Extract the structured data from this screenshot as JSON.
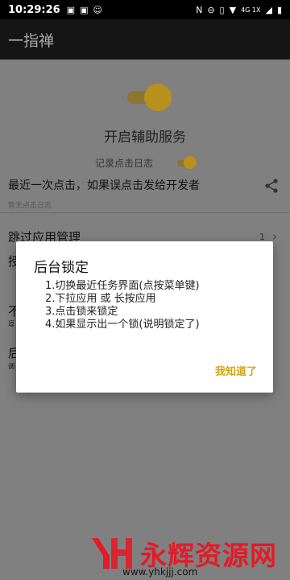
{
  "status_bar": {
    "time": "10:29:26",
    "left_icons": [
      "notification-icon",
      "notification-icon",
      "face-icon"
    ],
    "right_icons": [
      "nfc-icon",
      "dnd-icon",
      "vibrate-icon",
      "wifi-icon",
      "signal-icon",
      "battery-icon"
    ],
    "network_label": "4G 1X"
  },
  "app_bar": {
    "title": "一指禅"
  },
  "main": {
    "service_toggle_on": true,
    "service_title": "开启辅助服务",
    "log_label": "记录点击日志",
    "log_toggle_on": true,
    "recent_title": "最近一次点击，如果误点击发给开发者",
    "recent_sub": "暂无点击日志",
    "skip_title": "跳过应用管理",
    "skip_count": "1",
    "skip_chevron": "›",
    "peek_items": [
      "授",
      "不",
      "逗",
      "后",
      "调"
    ]
  },
  "dialog": {
    "title": "后台锁定",
    "lines": [
      "1.切换最近任务界面(点按菜单键)",
      "2.下拉应用 或 长按应用",
      "3.点击锁来锁定",
      "4.如果显示出一个锁(说明锁定了)"
    ],
    "ok_label": "我知道了"
  },
  "watermark": {
    "text": "永辉资源网",
    "url": "www.yhkjjj.com"
  },
  "colors": {
    "accent": "#d4a514",
    "brand_watermark": "#e21b27",
    "scrim_bg": "#808080",
    "appbar_bg": "#151515"
  }
}
